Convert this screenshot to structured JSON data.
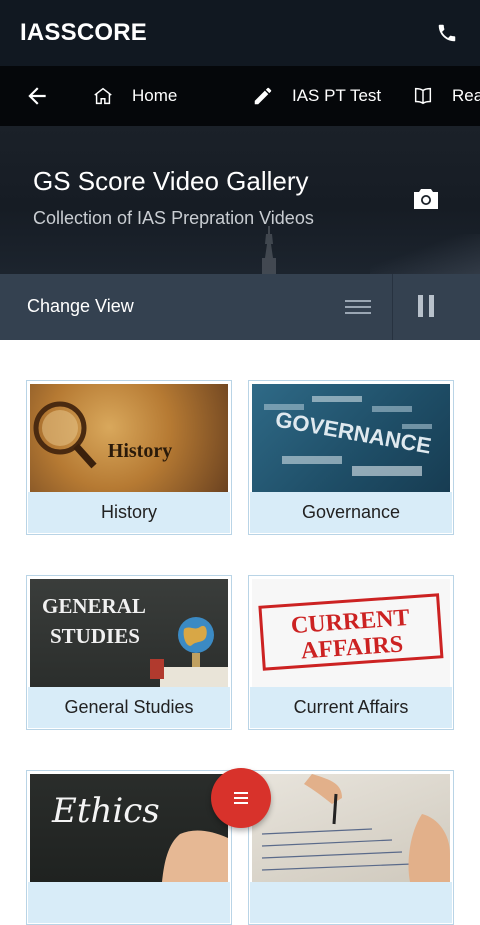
{
  "app": {
    "brand": "IASSCORE"
  },
  "nav": {
    "items": [
      {
        "label": "Home",
        "icon": "home-icon"
      },
      {
        "label": "IAS PT Test",
        "icon": "pencil-icon"
      },
      {
        "label": "Rea",
        "icon": "book-icon"
      }
    ]
  },
  "hero": {
    "title": "GS Score Video Gallery",
    "subtitle": "Collection of IAS Prepration Videos"
  },
  "viewbar": {
    "label": "Change View"
  },
  "cards": [
    {
      "label": "History",
      "thumb_text": "History"
    },
    {
      "label": "Governance",
      "thumb_text": "GOVERNANCE"
    },
    {
      "label": "General Studies",
      "thumb_text_1": "GENERAL",
      "thumb_text_2": "STUDIES"
    },
    {
      "label": "Current Affairs",
      "thumb_text_1": "CURRENT",
      "thumb_text_2": "AFFAIRS"
    },
    {
      "label": "",
      "thumb_text": "Ethics"
    },
    {
      "label": ""
    }
  ],
  "colors": {
    "appbar": "#111821",
    "navbar": "#05070a",
    "viewbar": "#344150",
    "card_label_bg": "#d8ecf8",
    "fab": "#d8322b"
  }
}
